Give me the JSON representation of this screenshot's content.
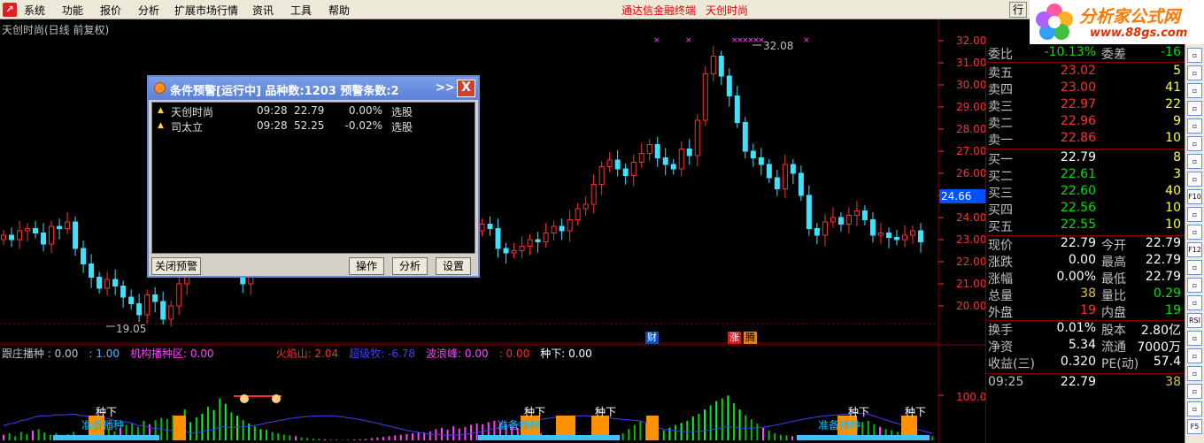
{
  "menu": {
    "items": [
      "系统",
      "功能",
      "报价",
      "分析",
      "扩展市场行情",
      "资讯",
      "工具",
      "帮助"
    ],
    "center_title": [
      "通达信金融终端",
      "天创时尚"
    ],
    "right_btn": "行"
  },
  "logo": {
    "text": "分析家公式网",
    "url": "www.88gs.com",
    "overlay": "天创时尚"
  },
  "chart": {
    "title": "天创时尚(日线 前复权)",
    "price_ticks": [
      "32.00",
      "31.00",
      "30.00",
      "29.00",
      "28.00",
      "27.00",
      "26.00",
      "25.00",
      "24.00",
      "23.00",
      "22.00",
      "21.00",
      "20.00"
    ],
    "current_price": "24.66",
    "high_label": "32.08",
    "low_label": "19.05",
    "badges": [
      "财",
      "涨",
      "腾"
    ],
    "indicator_tick": "100.0",
    "legend": [
      {
        "text": "跟庄播种 : 0.00",
        "color": "#c0c0c0"
      },
      {
        "text": ": 1.00",
        "color": "#40c0ff"
      },
      {
        "text": "机构播种区: 0.00",
        "color": "#ff40ff"
      },
      {
        "text": "火焰山: 2.04",
        "color": "#ff3030"
      },
      {
        "text": "超级牧: -6.78",
        "color": "#4040ff"
      },
      {
        "text": "波浪峰: 0.00",
        "color": "#ff40ff"
      },
      {
        "text": ": 0.00",
        "color": "#ff3030"
      },
      {
        "text": "种下: 0.00",
        "color": "#ffffff"
      }
    ],
    "zhongxia_label": "种下",
    "zhunbei_label": "准备播种"
  },
  "chart_data": {
    "type": "candlestick",
    "ylim": [
      19,
      32.5
    ],
    "series": [
      {
        "name": "price",
        "values": [
          23.2,
          23.0,
          23.4,
          23.5,
          23.3,
          22.8,
          23.6,
          23.5,
          23.8,
          22.6,
          21.9,
          21.3,
          20.8,
          21.2,
          20.9,
          20.4,
          20.1,
          19.6,
          20.5,
          20.2,
          19.4,
          20.0,
          21.0,
          21.8,
          22.4,
          22.0,
          22.6,
          23.1,
          22.5,
          21.8,
          21.0,
          22.4,
          22.6,
          23.3,
          24.3,
          24.7,
          24.2,
          24.7,
          24.0,
          23.7,
          24.1,
          24.3,
          23.4,
          23.2,
          23.9,
          22.6,
          22.8,
          23.4,
          22.9,
          22.8,
          23.1,
          22.6,
          22.8,
          23.7,
          24.2,
          24.3,
          23.8,
          23.3,
          23.2,
          23.4,
          23.7,
          23.5,
          22.6,
          22.4,
          22.5,
          22.7,
          23.0,
          22.9,
          23.3,
          23.6,
          23.4,
          23.9,
          24.4,
          24.6,
          25.5,
          26.3,
          26.6,
          26.2,
          25.9,
          26.5,
          26.9,
          27.3,
          26.7,
          26.4,
          26.2,
          27.1,
          26.8,
          28.4,
          30.5,
          31.3,
          30.4,
          29.5,
          28.3,
          27.0,
          26.7,
          26.4,
          25.8,
          25.3,
          26.4,
          26.0,
          25.0,
          23.5,
          23.2,
          23.8,
          24.0,
          23.7,
          24.1,
          24.3,
          23.9,
          23.2,
          23.3,
          23.1,
          23.0,
          23.2,
          23.4,
          22.9
        ]
      }
    ],
    "indicator_ylim": [
      0,
      200
    ],
    "indicator_values": [
      20,
      25,
      15,
      30,
      22,
      35,
      40,
      28,
      20,
      26,
      18,
      22,
      30,
      15,
      18,
      25,
      35,
      28,
      40,
      32,
      45,
      55,
      60,
      48,
      70,
      58,
      72,
      80,
      76,
      90,
      78,
      110,
      65,
      82,
      95,
      120,
      108,
      150,
      130,
      100,
      88,
      72,
      60,
      50,
      40,
      38,
      30,
      25,
      20,
      18,
      15,
      10,
      8,
      6,
      5,
      4,
      3,
      3,
      2,
      2,
      3,
      4,
      5,
      8,
      10,
      12,
      15,
      18,
      20,
      22,
      25,
      30,
      28,
      32,
      40,
      45,
      38,
      50,
      42,
      48,
      55,
      60,
      58,
      65,
      70,
      62,
      58,
      50,
      45,
      40,
      35,
      30,
      25,
      20,
      15,
      12,
      10,
      8,
      6,
      5,
      4,
      3,
      2,
      4,
      8,
      15,
      25,
      40,
      55,
      70,
      60,
      50,
      40,
      35,
      45,
      55,
      62,
      70,
      85,
      95,
      110,
      125,
      140,
      150,
      160,
      132,
      110,
      90,
      75,
      60,
      45,
      35,
      25,
      20,
      18,
      15,
      12,
      10,
      8,
      8,
      10,
      12,
      15,
      20,
      30,
      40,
      55,
      65,
      70,
      58,
      48,
      40,
      35,
      30,
      28,
      25,
      22,
      20,
      18,
      15
    ]
  },
  "quote": {
    "weibi": {
      "label": "委比",
      "value": "-10.13%",
      "label2": "委差",
      "value2": "-16"
    },
    "asks": [
      {
        "label": "卖五",
        "price": "23.02",
        "vol": "5"
      },
      {
        "label": "卖四",
        "price": "23.00",
        "vol": "41"
      },
      {
        "label": "卖三",
        "price": "22.97",
        "vol": "22"
      },
      {
        "label": "卖二",
        "price": "22.96",
        "vol": "9"
      },
      {
        "label": "卖一",
        "price": "22.86",
        "vol": "10"
      }
    ],
    "bids": [
      {
        "label": "买一",
        "price": "22.79",
        "vol": "8"
      },
      {
        "label": "买二",
        "price": "22.61",
        "vol": "3"
      },
      {
        "label": "买三",
        "price": "22.60",
        "vol": "40"
      },
      {
        "label": "买四",
        "price": "22.56",
        "vol": "10"
      },
      {
        "label": "买五",
        "price": "22.55",
        "vol": "10"
      }
    ],
    "stats": [
      {
        "l1": "现价",
        "v1": "22.79",
        "l2": "今开",
        "v2": "22.79"
      },
      {
        "l1": "涨跌",
        "v1": "0.00",
        "l2": "最高",
        "v2": "22.79"
      },
      {
        "l1": "涨幅",
        "v1": "0.00%",
        "l2": "最低",
        "v2": "22.79"
      },
      {
        "l1": "总量",
        "v1": "38",
        "l2": "量比",
        "v2": "0.29"
      },
      {
        "l1": "外盘",
        "v1": "19",
        "l2": "内盘",
        "v2": "19"
      }
    ],
    "fin": [
      {
        "l1": "换手",
        "v1": "0.01%",
        "l2": "股本",
        "v2": "2.80亿"
      },
      {
        "l1": "净资",
        "v1": "5.34",
        "l2": "流通",
        "v2": "7000万"
      },
      {
        "l1": "收益(三)",
        "v1": "0.320",
        "l2": "PE(动)",
        "v2": "57.4"
      }
    ],
    "tick": {
      "time": "09:25",
      "price": "22.79",
      "vol": "38"
    }
  },
  "toolbar": [
    "",
    "",
    "",
    "",
    "",
    "",
    "",
    "",
    "F10",
    "",
    "",
    "F12",
    "",
    "",
    "",
    "RSI",
    "",
    "",
    "",
    "",
    "",
    "F5"
  ],
  "dialog": {
    "title": "条件预警[运行中] 品种数:1203 预警条数:2",
    "more": ">>",
    "close": "X",
    "rows": [
      {
        "name": "天创时尚",
        "time": "09:28",
        "price": "22.79",
        "pct": "0.00%",
        "type": "选股"
      },
      {
        "name": "司太立",
        "time": "09:28",
        "price": "52.25",
        "pct": "-0.02%",
        "type": "选股"
      }
    ],
    "btn_close": "关闭预警",
    "btn_op": "操作",
    "btn_analyze": "分析",
    "btn_settings": "设置"
  }
}
